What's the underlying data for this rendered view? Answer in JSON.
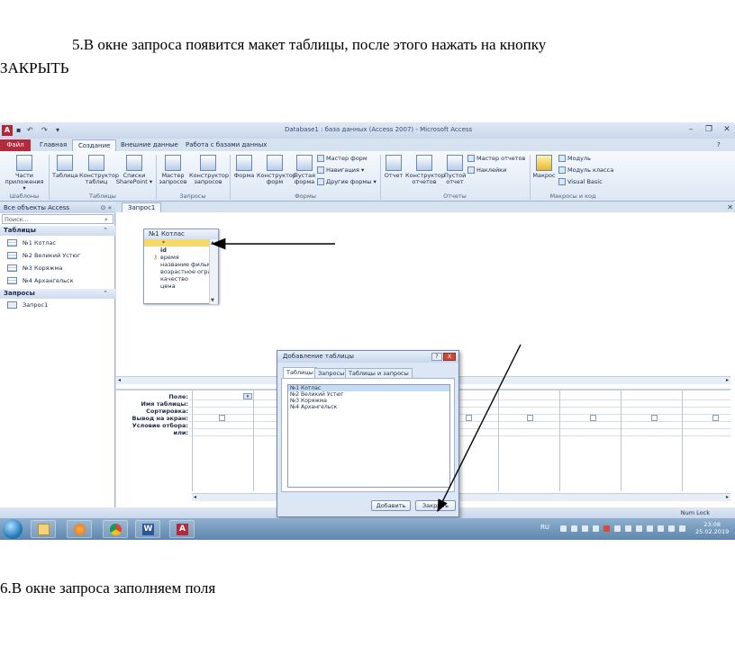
{
  "document": {
    "para1_line1": "5.В окне запроса появится макет таблицы, после этого нажать на кнопку",
    "para1_line2": "ЗАКРЫТЬ",
    "para2": "6.В окне запроса заполняем поля"
  },
  "window": {
    "title": "Database1 : база данных (Access 2007) - Microsoft Access",
    "app_icon": "A",
    "qat": [
      "save-icon",
      "undo-icon",
      "redo-icon",
      "customize-icon"
    ],
    "controls": [
      "minimize-icon",
      "restore-icon",
      "close-icon"
    ]
  },
  "ribbon": {
    "tabs": [
      "Файл",
      "Главная",
      "Создание",
      "Внешние данные",
      "Работа с базами данных"
    ],
    "active_tab": "Создание",
    "groups": [
      {
        "label": "Шаблоны",
        "buttons": [
          {
            "label": "Части приложения ▾"
          }
        ]
      },
      {
        "label": "Таблицы",
        "buttons": [
          {
            "label": "Таблица"
          },
          {
            "label": "Конструктор таблиц"
          },
          {
            "label": "Списки SharePoint ▾"
          }
        ]
      },
      {
        "label": "Запросы",
        "buttons": [
          {
            "label": "Мастер запросов"
          },
          {
            "label": "Конструктор запросов"
          }
        ]
      },
      {
        "label": "Формы",
        "buttons": [
          {
            "label": "Форма"
          },
          {
            "label": "Конструктор форм"
          },
          {
            "label": "Пустая форма"
          }
        ],
        "small": [
          "Мастер форм",
          "Навигация ▾",
          "Другие формы ▾"
        ]
      },
      {
        "label": "Отчеты",
        "buttons": [
          {
            "label": "Отчет"
          },
          {
            "label": "Конструктор отчетов"
          },
          {
            "label": "Пустой отчет"
          }
        ],
        "small": [
          "Мастер отчетов",
          "Наклейки"
        ]
      },
      {
        "label": "Макросы и код",
        "buttons": [
          {
            "label": "Макрос"
          }
        ],
        "small": [
          "Модуль",
          "Модуль класса",
          "Visual Basic"
        ]
      }
    ]
  },
  "nav": {
    "header": "Все объекты Access",
    "search_placeholder": "Поиск...",
    "categories": [
      {
        "label": "Таблицы",
        "items": [
          "№1 Котлас",
          "№2 Великий Устюг",
          "№3 Коряжма",
          "№4 Архангельск"
        ]
      },
      {
        "label": "Запросы",
        "items": [
          "Запрос1"
        ]
      }
    ]
  },
  "doc": {
    "tab_label": "Запрос1",
    "field_list": {
      "title": "№1 Котлас",
      "fields": [
        "*",
        "id",
        "время",
        "название фильма",
        "возрастное ограничение",
        "качество",
        "цена"
      ]
    },
    "grid_labels": [
      "Поле:",
      "Имя таблицы:",
      "Сортировка:",
      "Вывод на экран:",
      "Условие отбора:",
      "или:"
    ]
  },
  "dialog": {
    "title": "Добавление таблицы",
    "help": "?",
    "close": "X",
    "tabs": [
      "Таблицы",
      "Запросы",
      "Таблицы и запросы"
    ],
    "list": [
      "№1 Котлас",
      "№2 Великий Устюг",
      "№3 Коряжма",
      "№4 Архангельск"
    ],
    "add_label": "Добавить",
    "close_label": "Закрыть"
  },
  "status": {
    "numlock": "Num Lock"
  },
  "taskbar": {
    "lang": "RU",
    "time": "23:08",
    "date": "25.02.2019",
    "apps": [
      "explorer-icon",
      "media-player-icon",
      "chrome-icon",
      "word-icon",
      "access-icon"
    ]
  },
  "colors": {
    "file_tab": "#b22a3c",
    "highlight_row": "#f5d96e",
    "selection": "#c6dcf6"
  }
}
